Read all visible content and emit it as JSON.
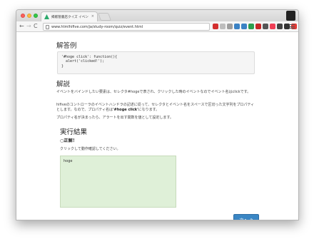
{
  "browser": {
    "tab_title": "掲帳管書店クイズ イベント",
    "tab_close": "×",
    "url": "www.htmlhifive.com/ja/study-room/quiz/event.html",
    "nav": {
      "back": "←",
      "forward": "→",
      "reload": "C"
    },
    "colors": {
      "tab_favicon": "#2aa96b",
      "light_red": "#fc605c",
      "light_yellow": "#fdbc40",
      "light_green": "#34c84a"
    },
    "extensions": [
      {
        "name": "block-icon",
        "color": "#d32f2f"
      },
      {
        "name": "star-icon",
        "color": "#bdbdbd"
      },
      {
        "name": "page-icon",
        "color": "#9e9e9e"
      },
      {
        "name": "globe-icon",
        "color": "#3b82c4"
      },
      {
        "name": "puzzle-icon",
        "color": "#3b82c4"
      },
      {
        "name": "check-icon",
        "color": "#2e9e4e"
      },
      {
        "name": "tag-icon",
        "color": "#c62828"
      },
      {
        "name": "camera-icon",
        "color": "#555555"
      },
      {
        "name": "pocket-icon",
        "color": "#ef3f56"
      },
      {
        "name": "image-icon",
        "color": "#444444"
      },
      {
        "name": "car-icon",
        "color": "#333333"
      },
      {
        "name": "rss-icon",
        "color": "#e53935"
      },
      {
        "name": "grid-icon",
        "color": "#1e88e5"
      },
      {
        "name": "tile-icon",
        "color": "#3949ab"
      }
    ]
  },
  "page": {
    "answer_heading": "解答例",
    "code_lines": [
      "'#hoge click': function(){",
      "  alert('clicked!');",
      "}"
    ],
    "explanation_heading": "解説",
    "para1": "イベントをバインドしたい要素は、セレクタ#hogeで表され、クリックした時のイベントなのでイベント名はclickです。",
    "para2_before": "hifiveのコントローラのイベントハンドラの記述に従って、セレクタとイベント名をスペースで区切った文字列をプロパティとします。なので、プロパティ名は",
    "para2_bold": "'#hoge click'",
    "para2_after": "になります。",
    "para3": "プロパティ名が決まったら、アラートを出す関数を値として設定します。",
    "result_heading": "実行結果",
    "result_text": "○正解！",
    "hint_text": "クリックして動作確認してください。",
    "box_text": "hoge",
    "next_button": "次へ",
    "next_arrow": "➲"
  }
}
